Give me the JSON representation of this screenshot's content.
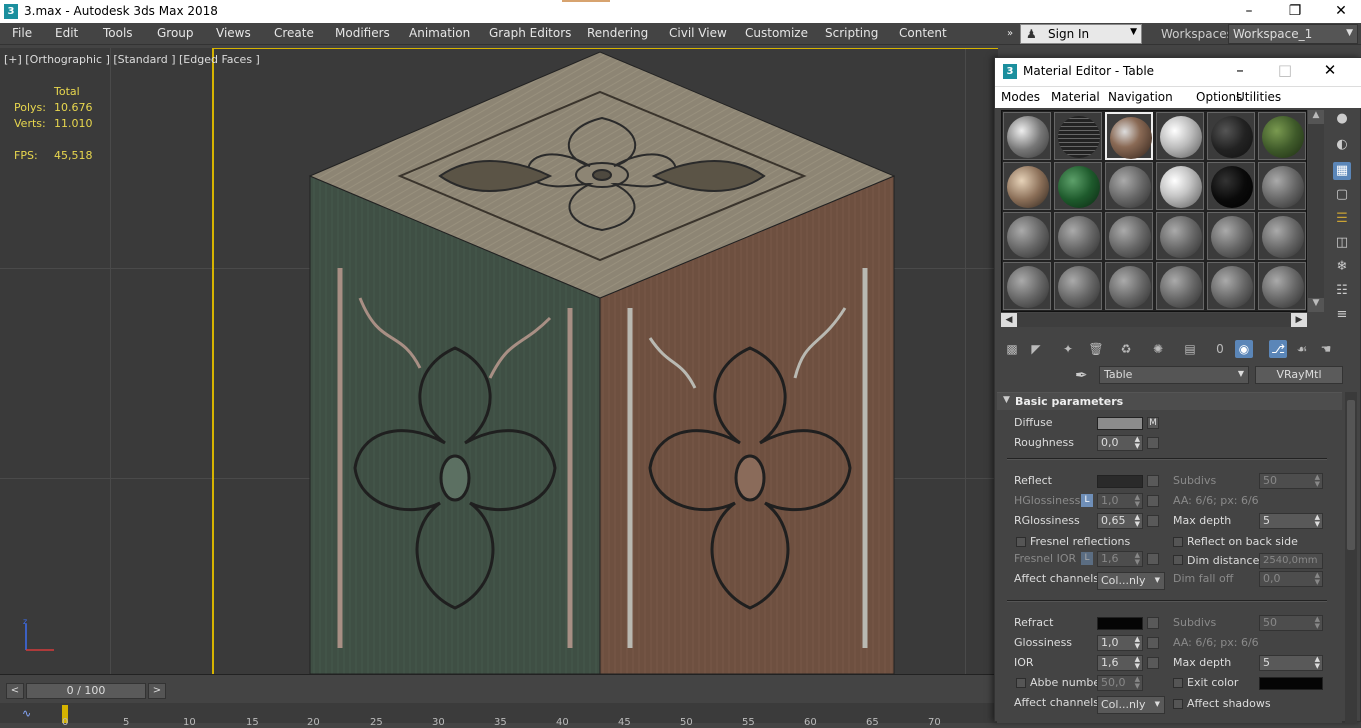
{
  "app": {
    "title": "3.max - Autodesk 3ds Max 2018",
    "logo": "3"
  },
  "menu": [
    "File",
    "Edit",
    "Tools",
    "Group",
    "Views",
    "Create",
    "Modifiers",
    "Animation",
    "Graph Editors",
    "Rendering",
    "Civil View",
    "Customize",
    "Scripting",
    "Content"
  ],
  "signin": {
    "label": "Sign In"
  },
  "workspace": {
    "label": "Workspaces:",
    "value": "Workspace_1"
  },
  "viewport": {
    "label": "[+] [Orthographic ] [Standard ] [Edged Faces ]",
    "stats": {
      "header": "Total",
      "polys_label": "Polys:",
      "polys": "10.676",
      "verts_label": "Verts:",
      "verts": "11.010",
      "fps_label": "FPS:",
      "fps": "45,518"
    }
  },
  "timeline": {
    "frame": "0 / 100",
    "prev": "<",
    "next": ">",
    "ticks": [
      "0",
      "5",
      "10",
      "15",
      "20",
      "25",
      "30",
      "35",
      "40",
      "45",
      "50",
      "55",
      "60",
      "65",
      "70"
    ]
  },
  "material_editor": {
    "title": "Material Editor - Table",
    "menu": [
      "Modes",
      "Material",
      "Navigation",
      "Options",
      "Utilities"
    ],
    "material_name": "Table",
    "material_type": "VRayMtl",
    "rollout": "Basic parameters",
    "diffuse": {
      "label": "Diffuse",
      "map": "M",
      "color": "#8c8c8c"
    },
    "roughness": {
      "label": "Roughness",
      "value": "0,0"
    },
    "reflect": {
      "label": "Reflect",
      "color": "#2a2a2a",
      "subdivs_label": "Subdivs",
      "subdivs": "50",
      "aa": "AA: 6/6; px: 6/6"
    },
    "hgloss": {
      "label": "HGlossiness",
      "lock": "L",
      "value": "1,0"
    },
    "rgloss": {
      "label": "RGlossiness",
      "value": "0,65",
      "maxdepth_label": "Max depth",
      "maxdepth": "5"
    },
    "fresnel": {
      "label": "Fresnel reflections",
      "backside": "Reflect on back side"
    },
    "fresnel_ior": {
      "label": "Fresnel IOR",
      "lock": "L",
      "value": "1,6",
      "dim_label": "Dim distance",
      "dim": "2540,0mm"
    },
    "affect_channels": {
      "label": "Affect channels",
      "value": "Col...nly",
      "falloff_label": "Dim fall off",
      "falloff": "0,0"
    },
    "refract": {
      "label": "Refract",
      "color": "#050505",
      "subdivs_label": "Subdivs",
      "subdivs": "50",
      "aa": "AA: 6/6; px: 6/6"
    },
    "glossiness": {
      "label": "Glossiness",
      "value": "1,0"
    },
    "ior": {
      "label": "IOR",
      "value": "1,6",
      "maxdepth_label": "Max depth",
      "maxdepth": "5"
    },
    "abbe": {
      "label": "Abbe number",
      "value": "50,0",
      "exit_label": "Exit color",
      "exit_color": "#050505"
    },
    "affect_channels2": {
      "label": "Affect channels",
      "value": "Col...nly",
      "shadows": "Affect shadows"
    }
  },
  "colors": {
    "accent_yellow": "#d6b400",
    "selection_blue": "#5b86b8",
    "stats_yellow": "#e8d74e"
  }
}
